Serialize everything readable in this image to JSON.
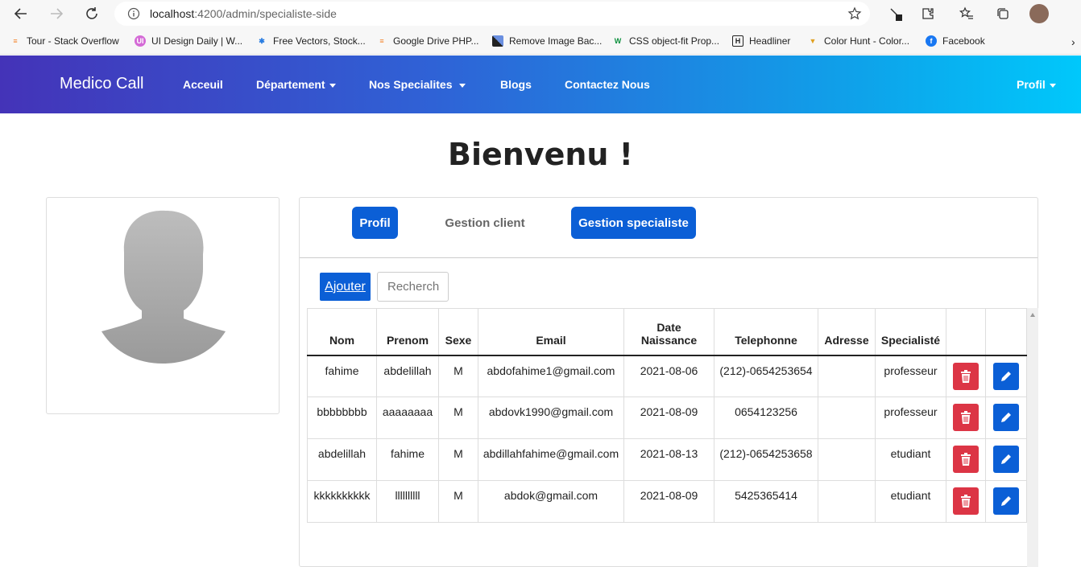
{
  "browser": {
    "url_host": "localhost",
    "url_path": ":4200/admin/specialiste-side",
    "bookmarks": [
      {
        "label": "Tour - Stack Overflow"
      },
      {
        "label": "UI Design Daily | W..."
      },
      {
        "label": "Free Vectors, Stock..."
      },
      {
        "label": "Google Drive PHP..."
      },
      {
        "label": "Remove Image Bac..."
      },
      {
        "label": "CSS object-fit Prop..."
      },
      {
        "label": "Headliner"
      },
      {
        "label": "Color Hunt - Color..."
      },
      {
        "label": "Facebook"
      }
    ]
  },
  "navbar": {
    "brand": "Medico Call",
    "links": {
      "accueil": "Acceuil",
      "departement": "Département",
      "specialites": "Nos Specialites",
      "blogs": "Blogs",
      "contact": "Contactez Nous",
      "profil": "Profil"
    }
  },
  "page": {
    "title": "Bienvenu !"
  },
  "tabs": {
    "profil": "Profil",
    "gestion_client": "Gestion client",
    "gestion_specialiste": "Gestion specialiste"
  },
  "toolbar": {
    "add_label": "Ajouter",
    "search_placeholder": "Recherch"
  },
  "table": {
    "headers": {
      "nom": "Nom",
      "prenom": "Prenom",
      "sexe": "Sexe",
      "email": "Email",
      "date1": "Date",
      "date2": "Naissance",
      "telephone": "Telephonne",
      "adresse": "Adresse",
      "specialite": "Specialisté"
    },
    "rows": [
      {
        "nom": "fahime",
        "prenom": "abdelillah",
        "sexe": "M",
        "email": "abdofahime1@gmail.com",
        "date": "2021-08-06",
        "tel": "(212)-0654253654",
        "adresse": "",
        "specialite": "professeur"
      },
      {
        "nom": "bbbbbbbb",
        "prenom": "aaaaaaaa",
        "sexe": "M",
        "email": "abdovk1990@gmail.com",
        "date": "2021-08-09",
        "tel": "0654123256",
        "adresse": "",
        "specialite": "professeur"
      },
      {
        "nom": "abdelillah",
        "prenom": "fahime",
        "sexe": "M",
        "email": "abdillahfahime@gmail.com",
        "date": "2021-08-13",
        "tel": "(212)-0654253658",
        "adresse": "",
        "specialite": "etudiant"
      },
      {
        "nom": "kkkkkkkkkk",
        "prenom": "llllllllll",
        "sexe": "M",
        "email": "abdok@gmail.com",
        "date": "2021-08-09",
        "tel": "5425365414",
        "adresse": "",
        "specialite": "etudiant"
      }
    ]
  },
  "colors": {
    "primary": "#0b5fd6",
    "danger": "#dc3545",
    "nav_start": "#4433b8",
    "nav_end": "#00c8fb"
  }
}
